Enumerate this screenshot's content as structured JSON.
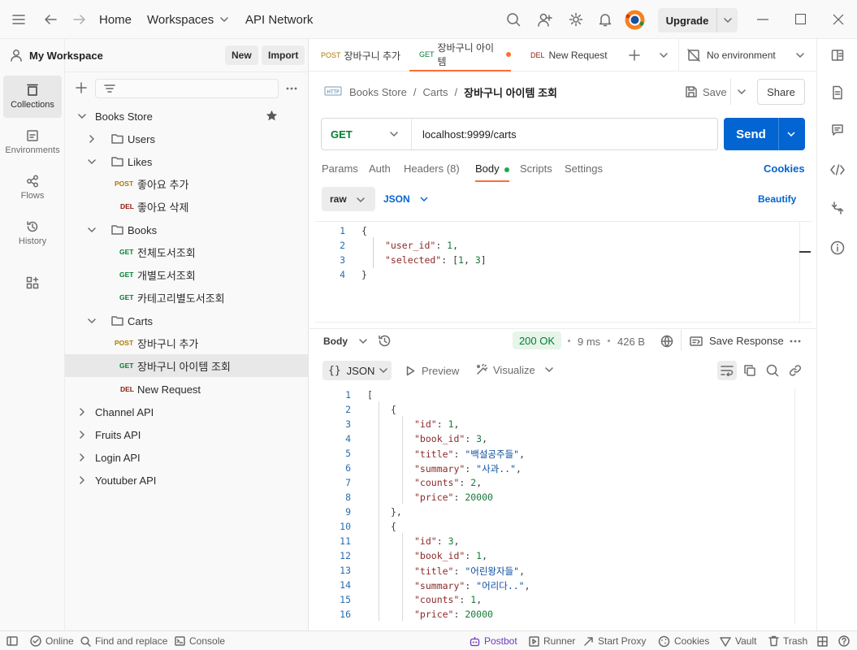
{
  "topbar": {
    "nav": [
      "Home",
      "Workspaces",
      "API Network"
    ],
    "upgrade_label": "Upgrade"
  },
  "rail": {
    "items": [
      {
        "label": "Collections",
        "icon": "collections-icon"
      },
      {
        "label": "Environments",
        "icon": "environments-icon"
      },
      {
        "label": "Flows",
        "icon": "flows-icon"
      },
      {
        "label": "History",
        "icon": "history-icon"
      }
    ]
  },
  "sidebar": {
    "workspace_name": "My Workspace",
    "new_label": "New",
    "import_label": "Import",
    "tree": [
      {
        "label": "Books Store",
        "type": "collection"
      },
      {
        "label": "Users",
        "type": "folder"
      },
      {
        "label": "Likes",
        "type": "folder"
      },
      {
        "label": "좋아요 추가",
        "method": "POST"
      },
      {
        "label": "좋아요 삭제",
        "method": "DEL"
      },
      {
        "label": "Books",
        "type": "folder"
      },
      {
        "label": "전체도서조회",
        "method": "GET"
      },
      {
        "label": "개별도서조회",
        "method": "GET"
      },
      {
        "label": "카테고리별도서조회",
        "method": "GET"
      },
      {
        "label": "Carts",
        "type": "folder"
      },
      {
        "label": "장바구니 추가",
        "method": "POST"
      },
      {
        "label": "장바구니 아이템 조회",
        "method": "GET"
      },
      {
        "label": "New Request",
        "method": "DEL"
      },
      {
        "label": "Channel API",
        "type": "collection"
      },
      {
        "label": "Fruits API",
        "type": "collection"
      },
      {
        "label": "Login API",
        "type": "collection"
      },
      {
        "label": "Youtuber API",
        "type": "collection"
      }
    ]
  },
  "tabs": [
    {
      "method": "POST",
      "label": "장바구니 추가"
    },
    {
      "method": "GET",
      "label": "장바구니 아이템"
    },
    {
      "method": "DEL",
      "label": "New Request"
    }
  ],
  "environment": "No environment",
  "breadcrumb": [
    "Books Store",
    "Carts",
    "장바구니 아이템 조회"
  ],
  "save_label": "Save",
  "share_label": "Share",
  "request": {
    "method": "GET",
    "url": "localhost:9999/carts",
    "send_label": "Send"
  },
  "request_tabs": [
    {
      "label": "Params"
    },
    {
      "label": "Auth"
    },
    {
      "label": "Headers",
      "count": "(8)"
    },
    {
      "label": "Body"
    },
    {
      "label": "Scripts"
    },
    {
      "label": "Settings"
    }
  ],
  "cookies_label": "Cookies",
  "body_mode": "raw",
  "body_format": "JSON",
  "beautify_label": "Beautify",
  "request_body_lines": [
    "1",
    "2",
    "3",
    "4"
  ],
  "response": {
    "label": "Body",
    "status": "200 OK",
    "time": "9 ms",
    "size": "426 B",
    "save_label": "Save Response",
    "format": "JSON",
    "preview_label": "Preview",
    "visualize_label": "Visualize",
    "line_numbers": [
      "1",
      "2",
      "3",
      "4",
      "5",
      "6",
      "7",
      "8",
      "9",
      "10",
      "11",
      "12",
      "13",
      "14",
      "15",
      "16"
    ]
  },
  "statusbar": {
    "online": "Online",
    "find_replace": "Find and replace",
    "console": "Console",
    "postbot": "Postbot",
    "runner": "Runner",
    "start_proxy": "Start Proxy",
    "cookies": "Cookies",
    "vault": "Vault",
    "trash": "Trash"
  },
  "colors": {
    "send_blue": "#0265d2",
    "accent_orange": "#ff6c37",
    "status_green": "#007f31"
  }
}
